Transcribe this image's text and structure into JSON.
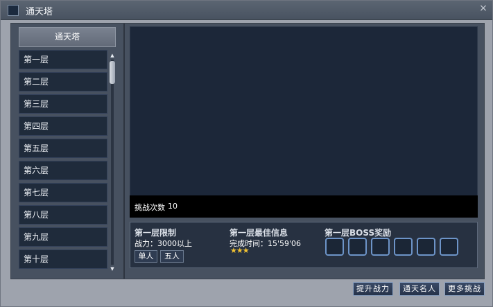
{
  "window": {
    "title": "通天塔",
    "close_glyph": "×"
  },
  "left_panel": {
    "header": "通天塔",
    "floors": [
      "第一层",
      "第二层",
      "第三层",
      "第四层",
      "第五层",
      "第六层",
      "第七层",
      "第八层",
      "第九层",
      "第十层"
    ]
  },
  "preview": {
    "challenge_label": "挑战次数",
    "challenge_count": "10"
  },
  "limit": {
    "title": "第一层限制",
    "power": "战力：3000以上",
    "single_button": "单人",
    "five_button": "五人"
  },
  "best": {
    "title": "第一层最佳信息",
    "time": "完成时间：15'59'06",
    "stars": "★★★"
  },
  "boss_reward": {
    "title": "第一层BOSS奖励",
    "slot_count": 6
  },
  "footer": {
    "raise_power": "提升战力",
    "famous": "通天名人",
    "more": "更多挑战"
  },
  "colors": {
    "star": "#f1c232",
    "slot_border": "#6d94c8",
    "panel": "#475160"
  },
  "icons": {
    "close": "close-icon",
    "scroll_up": "scroll-up-arrow-icon",
    "scroll_down": "scroll-down-arrow-icon",
    "window": "window-icon"
  }
}
